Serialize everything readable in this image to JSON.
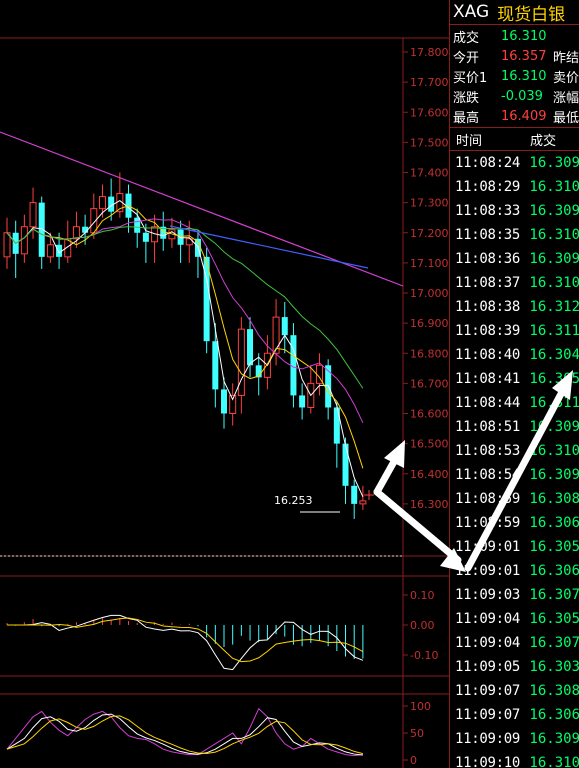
{
  "header": {
    "symbol": "XAG",
    "name": "现货白银"
  },
  "quote": [
    {
      "label": "成交",
      "value": "16.310",
      "color": "green",
      "label2": ""
    },
    {
      "label": "今开",
      "value": "16.357",
      "color": "red",
      "label2": "昨结"
    },
    {
      "label": "买价1",
      "value": "16.310",
      "color": "green",
      "label2": "卖价"
    },
    {
      "label": "涨跌",
      "value": "-0.039",
      "color": "green",
      "label2": "涨幅"
    },
    {
      "label": "最高",
      "value": "16.409",
      "color": "red",
      "label2": "最低"
    }
  ],
  "ticks_header": {
    "time": "时间",
    "price": "成交"
  },
  "ticks": [
    {
      "time": "11:08:24",
      "price": "16.309"
    },
    {
      "time": "11:08:29",
      "price": "16.310"
    },
    {
      "time": "11:08:33",
      "price": "16.309"
    },
    {
      "time": "11:08:35",
      "price": "16.310"
    },
    {
      "time": "11:08:36",
      "price": "16.309"
    },
    {
      "time": "11:08:37",
      "price": "16.310"
    },
    {
      "time": "11:08:38",
      "price": "16.312"
    },
    {
      "time": "11:08:39",
      "price": "16.311"
    },
    {
      "time": "11:08:40",
      "price": "16.304"
    },
    {
      "time": "11:08:41",
      "price": "16.305"
    },
    {
      "time": "11:08:44",
      "price": "16.311"
    },
    {
      "time": "11:08:51",
      "price": "16.309"
    },
    {
      "time": "11:08:53",
      "price": "16.310"
    },
    {
      "time": "11:08:54",
      "price": "16.309"
    },
    {
      "time": "11:08:59",
      "price": "16.308"
    },
    {
      "time": "11:08:59",
      "price": "16.306"
    },
    {
      "time": "11:09:01",
      "price": "16.305"
    },
    {
      "time": "11:09:01",
      "price": "16.306"
    },
    {
      "time": "11:09:03",
      "price": "16.307"
    },
    {
      "time": "11:09:04",
      "price": "16.305"
    },
    {
      "time": "11:09:04",
      "price": "16.307"
    },
    {
      "time": "11:09:05",
      "price": "16.303"
    },
    {
      "time": "11:09:07",
      "price": "16.308"
    },
    {
      "time": "11:09:07",
      "price": "16.306"
    },
    {
      "time": "11:09:09",
      "price": "16.309"
    },
    {
      "time": "11:09:10",
      "price": "16.310"
    }
  ],
  "chart_data": {
    "type": "candlestick",
    "price_axis": {
      "min": 16.2,
      "max": 17.8,
      "ticks": [
        "17.800",
        "17.700",
        "17.600",
        "17.500",
        "17.400",
        "17.300",
        "17.200",
        "17.100",
        "17.000",
        "16.900",
        "16.800",
        "16.700",
        "16.600",
        "16.500",
        "16.400",
        "16.300"
      ]
    },
    "last_low_label": "16.253",
    "macd_axis": {
      "ticks": [
        "0.10",
        "0.00",
        "-0.10"
      ]
    },
    "kdj_axis": {
      "ticks": [
        "100",
        "50",
        "0"
      ]
    },
    "candles": [
      {
        "o": 17.12,
        "c": 17.2,
        "h": 17.25,
        "l": 17.08
      },
      {
        "o": 17.2,
        "c": 17.13,
        "h": 17.24,
        "l": 17.05
      },
      {
        "o": 17.13,
        "c": 17.22,
        "h": 17.26,
        "l": 17.1
      },
      {
        "o": 17.22,
        "c": 17.3,
        "h": 17.35,
        "l": 17.18
      },
      {
        "o": 17.3,
        "c": 17.12,
        "h": 17.32,
        "l": 17.08
      },
      {
        "o": 17.12,
        "c": 17.16,
        "h": 17.2,
        "l": 17.1
      },
      {
        "o": 17.16,
        "c": 17.12,
        "h": 17.2,
        "l": 17.08
      },
      {
        "o": 17.12,
        "c": 17.18,
        "h": 17.24,
        "l": 17.1
      },
      {
        "o": 17.18,
        "c": 17.22,
        "h": 17.27,
        "l": 17.15
      },
      {
        "o": 17.22,
        "c": 17.2,
        "h": 17.26,
        "l": 17.16
      },
      {
        "o": 17.2,
        "c": 17.28,
        "h": 17.33,
        "l": 17.18
      },
      {
        "o": 17.28,
        "c": 17.32,
        "h": 17.36,
        "l": 17.25
      },
      {
        "o": 17.32,
        "c": 17.27,
        "h": 17.38,
        "l": 17.24
      },
      {
        "o": 17.27,
        "c": 17.33,
        "h": 17.4,
        "l": 17.25
      },
      {
        "o": 17.33,
        "c": 17.25,
        "h": 17.36,
        "l": 17.2
      },
      {
        "o": 17.25,
        "c": 17.2,
        "h": 17.28,
        "l": 17.15
      },
      {
        "o": 17.2,
        "c": 17.17,
        "h": 17.23,
        "l": 17.1
      },
      {
        "o": 17.17,
        "c": 17.22,
        "h": 17.26,
        "l": 17.1
      },
      {
        "o": 17.22,
        "c": 17.18,
        "h": 17.27,
        "l": 17.14
      },
      {
        "o": 17.18,
        "c": 17.21,
        "h": 17.25,
        "l": 17.15
      },
      {
        "o": 17.21,
        "c": 17.16,
        "h": 17.24,
        "l": 17.1
      },
      {
        "o": 17.16,
        "c": 17.18,
        "h": 17.24,
        "l": 17.1
      },
      {
        "o": 17.18,
        "c": 17.12,
        "h": 17.21,
        "l": 17.05
      },
      {
        "o": 17.12,
        "c": 16.84,
        "h": 17.15,
        "l": 16.8
      },
      {
        "o": 16.84,
        "c": 16.68,
        "h": 16.9,
        "l": 16.62
      },
      {
        "o": 16.68,
        "c": 16.6,
        "h": 16.72,
        "l": 16.55
      },
      {
        "o": 16.6,
        "c": 16.66,
        "h": 16.7,
        "l": 16.56
      },
      {
        "o": 16.66,
        "c": 16.88,
        "h": 16.92,
        "l": 16.6
      },
      {
        "o": 16.88,
        "c": 16.76,
        "h": 16.92,
        "l": 16.72
      },
      {
        "o": 16.76,
        "c": 16.72,
        "h": 16.8,
        "l": 16.66
      },
      {
        "o": 16.72,
        "c": 16.8,
        "h": 16.86,
        "l": 16.68
      },
      {
        "o": 16.8,
        "c": 16.92,
        "h": 16.98,
        "l": 16.76
      },
      {
        "o": 16.92,
        "c": 16.86,
        "h": 16.97,
        "l": 16.8
      },
      {
        "o": 16.86,
        "c": 16.66,
        "h": 16.9,
        "l": 16.62
      },
      {
        "o": 16.66,
        "c": 16.62,
        "h": 16.7,
        "l": 16.58
      },
      {
        "o": 16.62,
        "c": 16.7,
        "h": 16.76,
        "l": 16.6
      },
      {
        "o": 16.7,
        "c": 16.76,
        "h": 16.8,
        "l": 16.66
      },
      {
        "o": 16.76,
        "c": 16.62,
        "h": 16.78,
        "l": 16.58
      },
      {
        "o": 16.62,
        "c": 16.5,
        "h": 16.64,
        "l": 16.42
      },
      {
        "o": 16.5,
        "c": 16.36,
        "h": 16.52,
        "l": 16.3
      },
      {
        "o": 16.36,
        "c": 16.3,
        "h": 16.38,
        "l": 16.25
      },
      {
        "o": 16.3,
        "c": 16.31,
        "h": 16.36,
        "l": 16.28
      }
    ]
  }
}
